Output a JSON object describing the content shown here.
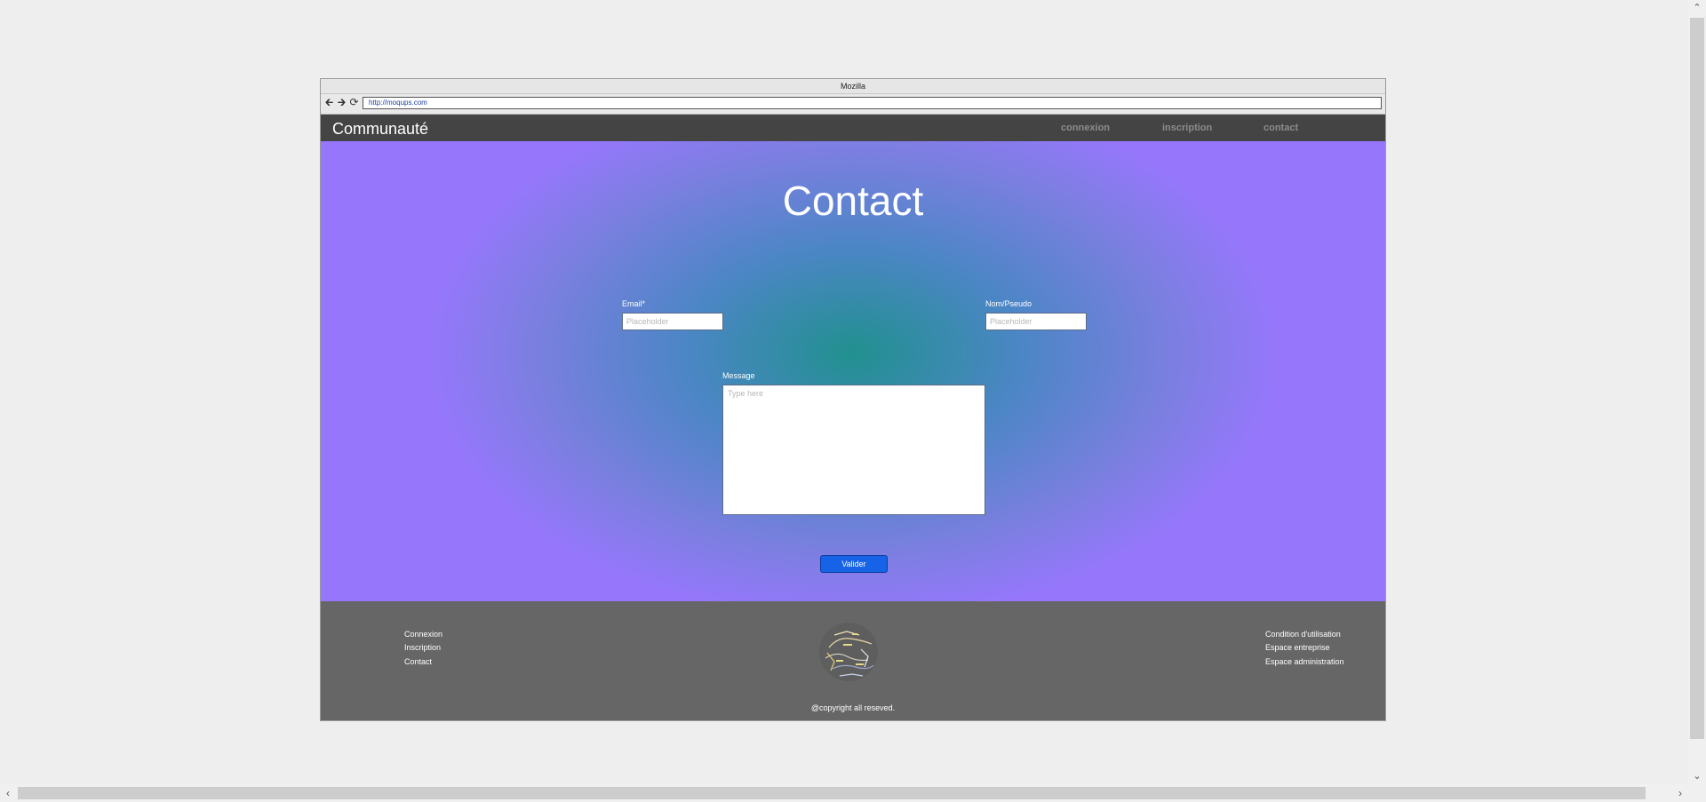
{
  "browser": {
    "window_title": "Mozilla",
    "url": "http://moqups.com",
    "back_icon": "arrow-left-icon",
    "forward_icon": "arrow-right-icon",
    "reload_icon": "reload-icon"
  },
  "header": {
    "brand": "Communauté",
    "nav": [
      {
        "label": "connexion"
      },
      {
        "label": "inscription"
      },
      {
        "label": "contact"
      }
    ]
  },
  "hero": {
    "title": "Contact",
    "email_label": "Email*",
    "email_placeholder": "Placeholder",
    "name_label": "Nom/Pseudo",
    "name_placeholder": "Placeholder",
    "message_label": "Message",
    "message_placeholder": "Type here",
    "submit_label": "Valider",
    "colors": {
      "center": "#21908f",
      "edge": "#9677fc",
      "button": "#1663e8"
    }
  },
  "footer": {
    "left_links": [
      "Connexion",
      "Inscription",
      "Contact"
    ],
    "right_links": [
      "Condition d'utilisation",
      "Espace entreprise",
      "Espace administration"
    ],
    "logo": "word-cloud-logo",
    "copyright": "@copyright all reseved."
  },
  "colors": {
    "header_bg": "#444444",
    "footer_bg": "#666666",
    "page_bg": "#eeeeee"
  }
}
